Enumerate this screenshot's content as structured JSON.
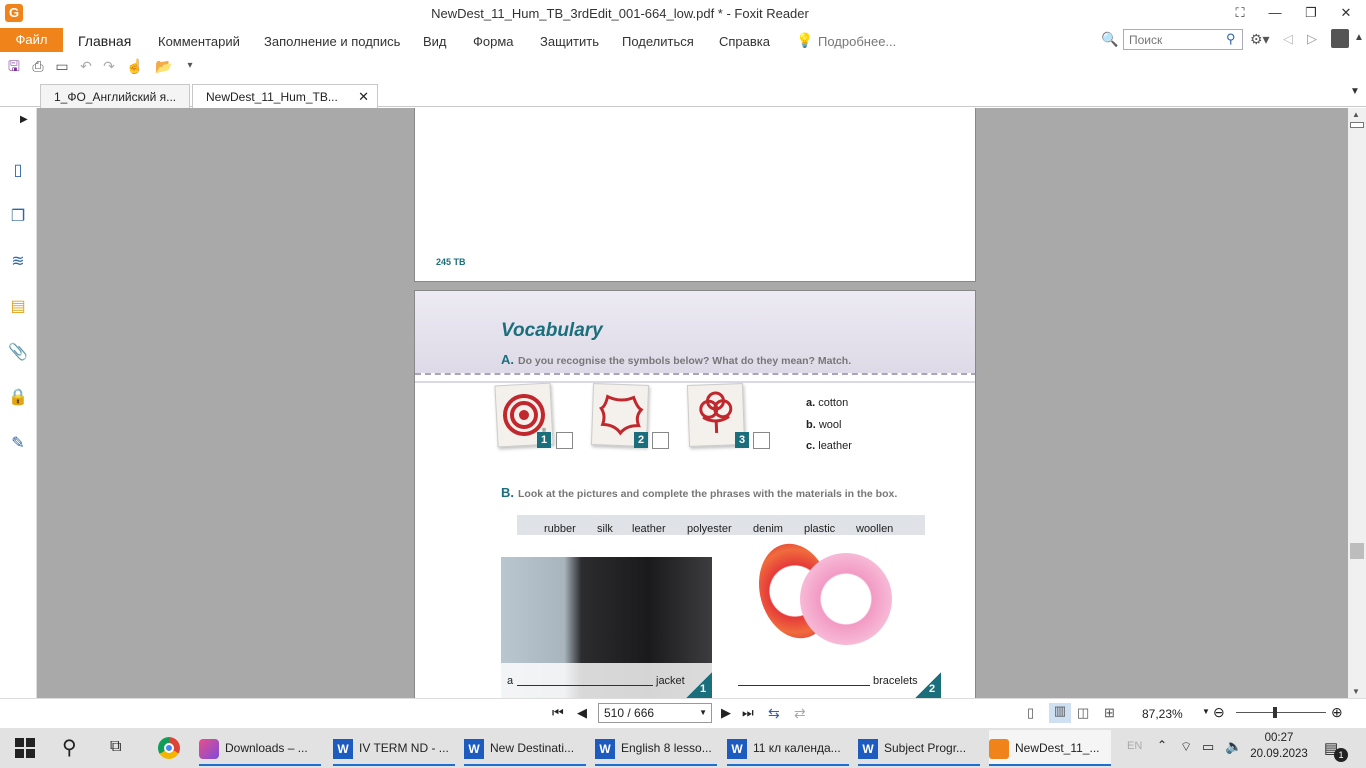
{
  "window": {
    "title": "NewDest_11_Hum_TB_3rdEdit_001-664_low.pdf * - Foxit Reader"
  },
  "menu": {
    "file": "Файл",
    "items": [
      "Главная",
      "Комментарий",
      "Заполнение и подпись",
      "Вид",
      "Форма",
      "Защитить",
      "Поделиться",
      "Справка"
    ],
    "tell_me": "Подробнее...",
    "search_placeholder": "Поиск"
  },
  "tabs": [
    {
      "label": "1_ФО_Английский я..."
    },
    {
      "label": "NewDest_11_Hum_TB..."
    }
  ],
  "page_prev": {
    "footer": "245 TB"
  },
  "page": {
    "section_title": "Vocabulary",
    "a_letter": "A.",
    "a_instruction": "Do you recognise the symbols below? What do they mean? Match.",
    "symbol_numbers": [
      "1",
      "2",
      "3"
    ],
    "options": [
      {
        "letter": "a.",
        "text": "cotton"
      },
      {
        "letter": "b.",
        "text": "wool"
      },
      {
        "letter": "c.",
        "text": "leather"
      }
    ],
    "b_letter": "B.",
    "b_instruction": "Look at the pictures and complete the phrases with the materials in the box.",
    "box_words": [
      "rubber",
      "silk",
      "leather",
      "polyester",
      "denim",
      "plastic",
      "woollen"
    ],
    "phrase1_prefix": "a",
    "phrase1_suffix": "jacket",
    "phrase1_num": "1",
    "phrase2_suffix": "bracelets",
    "phrase2_num": "2",
    "registered": "®"
  },
  "status": {
    "page_indicator": "510 / 666",
    "zoom": "87,23%"
  },
  "taskbar": {
    "items": [
      {
        "label": "Downloads – ..."
      },
      {
        "label": "IV TERM ND - ..."
      },
      {
        "label": "New Destinati..."
      },
      {
        "label": "English 8 lesso..."
      },
      {
        "label": "11 кл календа..."
      },
      {
        "label": "Subject Progr..."
      },
      {
        "label": "NewDest_11_..."
      }
    ],
    "word_letter": "W",
    "lang": "EN",
    "time": "00:27",
    "date": "20.09.2023",
    "notification_count": "1"
  },
  "colors": {
    "accent_orange": "#f0841a",
    "title_teal": "#1b6f7c",
    "word_blue": "#1d5bbf"
  }
}
